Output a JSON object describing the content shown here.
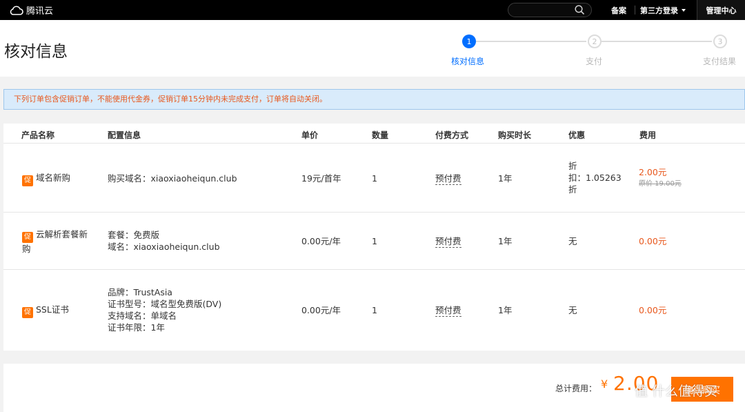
{
  "topbar": {
    "logo_text": "腾讯云",
    "nav_beian": "备案",
    "nav_third": "第三方登录",
    "nav_admin": "管理中心"
  },
  "header": {
    "title": "核对信息",
    "steps": [
      {
        "num": "1",
        "label": "核对信息",
        "state": "active"
      },
      {
        "num": "2",
        "label": "支付",
        "state": "inactive"
      },
      {
        "num": "3",
        "label": "支付结果",
        "state": "inactive"
      }
    ]
  },
  "notice": "下列订单包含促销订单，不能使用代金券，促销订单15分钟内未完成支付，订单将自动关闭。",
  "table": {
    "headers": [
      "产品名称",
      "配置信息",
      "单价",
      "数量",
      "付费方式",
      "购买时长",
      "优惠",
      "费用"
    ],
    "promo_badge": "促",
    "rows": [
      {
        "name": "域名新购",
        "config": [
          "购买域名：xiaoxiaoheiqun.club"
        ],
        "price": "19元/首年",
        "qty": "1",
        "pay": "预付费",
        "duration": "1年",
        "discount": [
          "折",
          "扣：1.05263",
          "折"
        ],
        "fee": "2.00元",
        "original": "原价 19.00元"
      },
      {
        "name_line1": "云解析套餐新",
        "name_line2": "购",
        "config": [
          "套餐：免费版",
          "域名：xiaoxiaoheiqun.club"
        ],
        "price": "0.00元/年",
        "qty": "1",
        "pay": "预付费",
        "duration": "1年",
        "discount": "无",
        "fee": "0.00元"
      },
      {
        "name": "SSL证书",
        "config": [
          "品牌：TrustAsia",
          "证书型号：域名型免费版(DV)",
          "支持域名：单域名",
          "证书年限：1年"
        ],
        "price": "0.00元/年",
        "qty": "1",
        "pay": "预付费",
        "duration": "1年",
        "discount": "无",
        "fee": "0.00元"
      }
    ]
  },
  "footer": {
    "total_label": "总计费用：",
    "currency": "¥",
    "total_value": "2.00",
    "confirm_label": "确认购买"
  },
  "watermark": "值 什么值得买",
  "colors": {
    "accent_blue": "#006eff",
    "accent_orange": "#ff7200",
    "fee_red": "#e8581d"
  }
}
